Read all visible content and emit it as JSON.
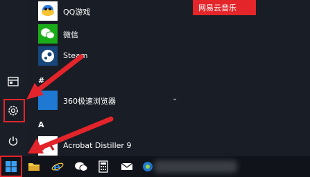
{
  "banner": {
    "text": "网易云音乐"
  },
  "apps": [
    {
      "label": "QQ游戏",
      "icon": "qq-game-icon"
    },
    {
      "label": "微信",
      "icon": "wechat-icon"
    },
    {
      "label": "Steam",
      "icon": "steam-icon"
    },
    {
      "label": "360极速浏览器",
      "icon": "360-browser-tile",
      "expand": "⌄"
    },
    {
      "label": "Acrobat Distiller 9",
      "icon": "acrobat-distiller-icon"
    }
  ],
  "sections": [
    {
      "letter": "#"
    },
    {
      "letter": "A"
    }
  ],
  "sidebar": {
    "items": [
      "documents-icon",
      "settings-gear-icon",
      "power-icon"
    ]
  },
  "taskbar": {
    "items": [
      "windows-start-icon",
      "file-explorer-icon",
      "internet-explorer-icon",
      "wechat-taskbar-icon",
      "calculator-icon",
      "mail-icon",
      "app-icon"
    ]
  },
  "colors": {
    "accent_red": "#e3242b",
    "tile_blue": "#1f78d1",
    "background": "#191d25"
  }
}
